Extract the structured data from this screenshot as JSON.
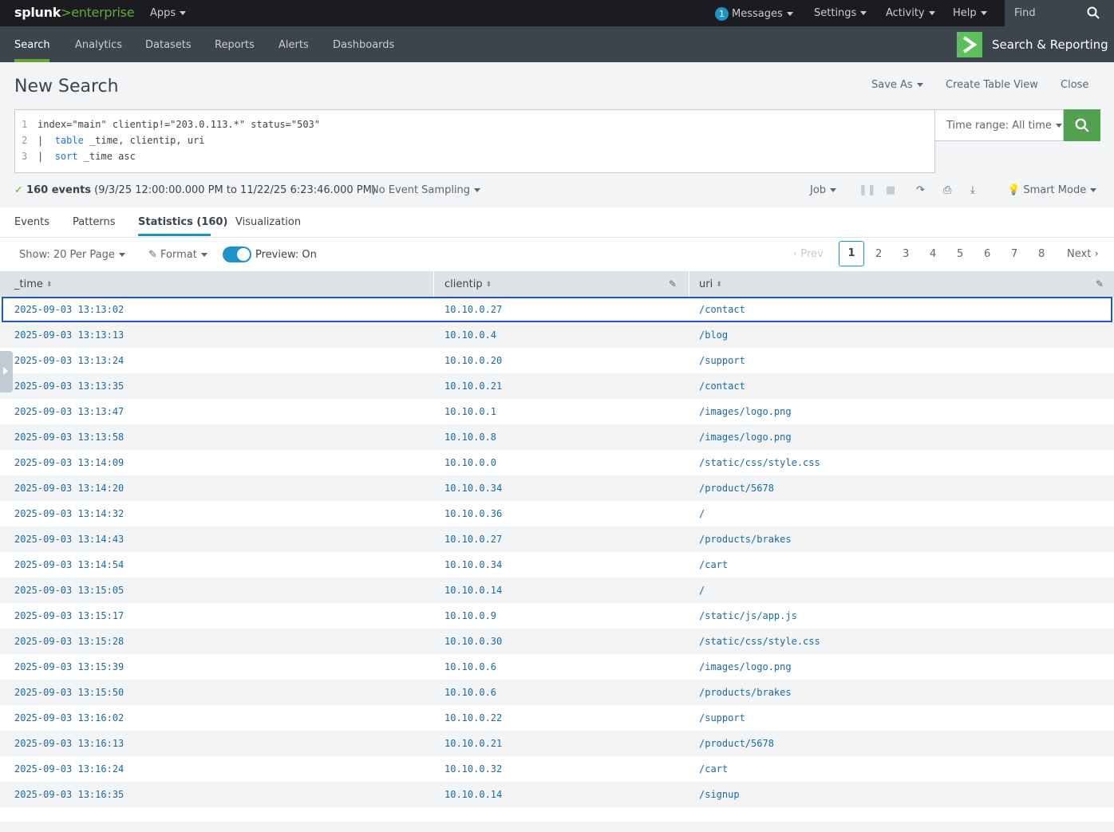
{
  "topbar": {
    "logo_brand": "splunk",
    "logo_gt": ">",
    "logo_product": "enterprise",
    "apps_label": "Apps",
    "messages_count": "1",
    "messages_label": "Messages",
    "settings_label": "Settings",
    "activity_label": "Activity",
    "help_label": "Help",
    "find_placeholder": "Find"
  },
  "nav": {
    "tabs": [
      "Search",
      "Analytics",
      "Datasets",
      "Reports",
      "Alerts",
      "Dashboards"
    ],
    "app_title": "Search & Reporting"
  },
  "header": {
    "title": "New Search",
    "save_as": "Save As",
    "create_table_view": "Create Table View",
    "close": "Close"
  },
  "search": {
    "lines": [
      {
        "num": "1",
        "text": "index=\"main\" clientip!=\"203.0.113.*\" status=\"503\""
      },
      {
        "num": "2",
        "pipe": "|  ",
        "kw": "table",
        "text": " _time, clientip, uri"
      },
      {
        "num": "3",
        "pipe": "|  ",
        "kw": "sort",
        "text": " _time asc"
      }
    ],
    "time_range": "Time range: All time"
  },
  "status": {
    "events": "160 events",
    "range": "(9/3/25 12:00:00.000 PM to 11/22/25 6:23:46.000 PM)",
    "sampling": "No Event Sampling",
    "job": "Job",
    "smart_mode": "Smart Mode"
  },
  "tabs": [
    "Events",
    "Patterns",
    "Statistics (160)",
    "Visualization"
  ],
  "toolbar": {
    "show": "Show: 20 Per Page",
    "format": "Format",
    "preview": "Preview: On",
    "prev": "Prev",
    "pages": [
      "1",
      "2",
      "3",
      "4",
      "5",
      "6",
      "7",
      "8"
    ],
    "next": "Next"
  },
  "table": {
    "columns": [
      "_time",
      "clientip",
      "uri"
    ],
    "rows": [
      [
        "2025-09-03 13:13:02",
        "10.10.0.27",
        "/contact"
      ],
      [
        "2025-09-03 13:13:13",
        "10.10.0.4",
        "/blog"
      ],
      [
        "2025-09-03 13:13:24",
        "10.10.0.20",
        "/support"
      ],
      [
        "2025-09-03 13:13:35",
        "10.10.0.21",
        "/contact"
      ],
      [
        "2025-09-03 13:13:47",
        "10.10.0.1",
        "/images/logo.png"
      ],
      [
        "2025-09-03 13:13:58",
        "10.10.0.8",
        "/images/logo.png"
      ],
      [
        "2025-09-03 13:14:09",
        "10.10.0.0",
        "/static/css/style.css"
      ],
      [
        "2025-09-03 13:14:20",
        "10.10.0.34",
        "/product/5678"
      ],
      [
        "2025-09-03 13:14:32",
        "10.10.0.36",
        "/"
      ],
      [
        "2025-09-03 13:14:43",
        "10.10.0.27",
        "/products/brakes"
      ],
      [
        "2025-09-03 13:14:54",
        "10.10.0.34",
        "/cart"
      ],
      [
        "2025-09-03 13:15:05",
        "10.10.0.14",
        "/"
      ],
      [
        "2025-09-03 13:15:17",
        "10.10.0.9",
        "/static/js/app.js"
      ],
      [
        "2025-09-03 13:15:28",
        "10.10.0.30",
        "/static/css/style.css"
      ],
      [
        "2025-09-03 13:15:39",
        "10.10.0.6",
        "/images/logo.png"
      ],
      [
        "2025-09-03 13:15:50",
        "10.10.0.6",
        "/products/brakes"
      ],
      [
        "2025-09-03 13:16:02",
        "10.10.0.22",
        "/support"
      ],
      [
        "2025-09-03 13:16:13",
        "10.10.0.21",
        "/product/5678"
      ],
      [
        "2025-09-03 13:16:24",
        "10.10.0.32",
        "/cart"
      ],
      [
        "2025-09-03 13:16:35",
        "10.10.0.14",
        "/signup"
      ]
    ]
  },
  "colors": {
    "accent_green": "#65a637",
    "accent_blue": "#1e93c6",
    "topbar": "#1a1c20",
    "navbar": "#3c444d"
  }
}
